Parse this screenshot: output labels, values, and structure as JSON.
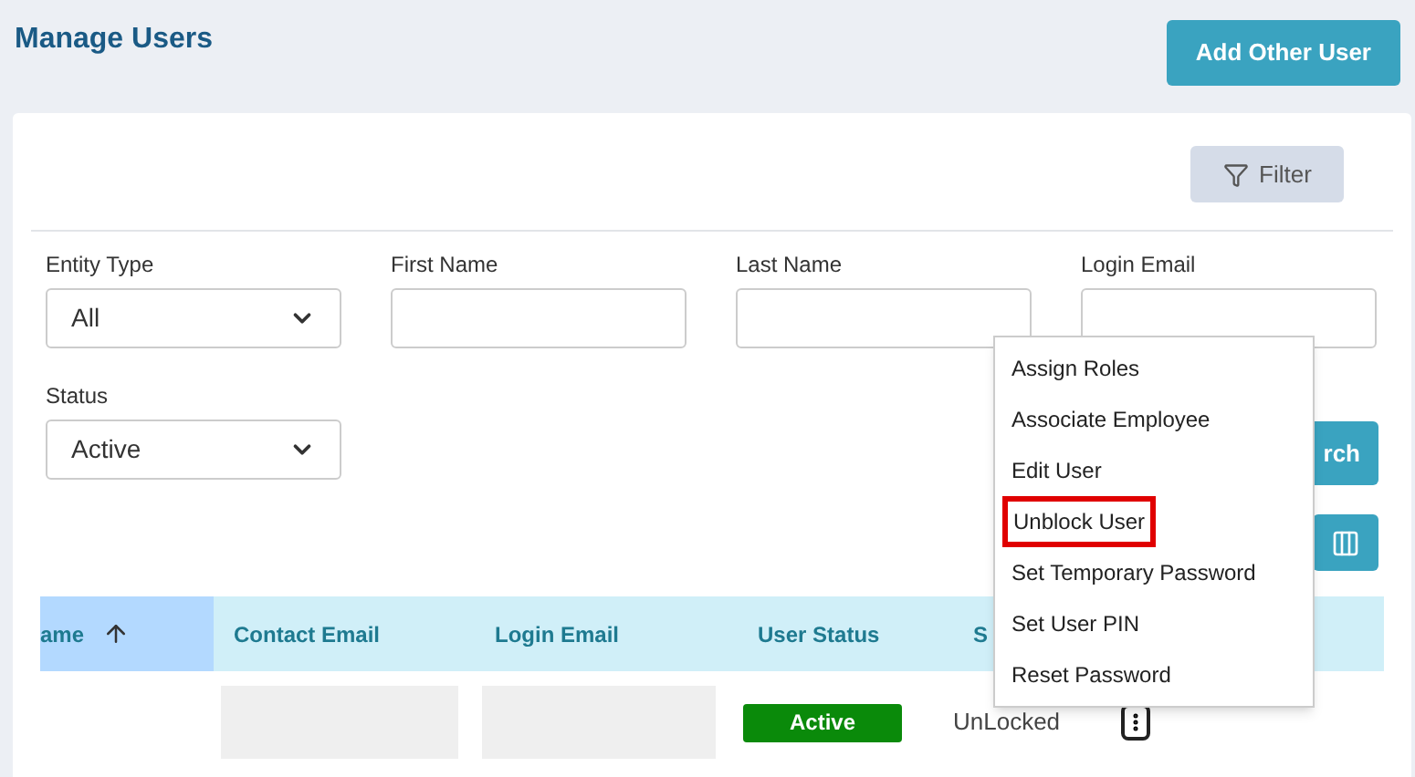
{
  "title": "Manage Users",
  "add_button": "Add Other User",
  "filter_button": "Filter",
  "filters": [
    {
      "label": "Entity Type",
      "kind": "select",
      "value": "All"
    },
    {
      "label": "First Name",
      "kind": "text"
    },
    {
      "label": "Last Name",
      "kind": "text"
    },
    {
      "label": "Login Email",
      "kind": "text"
    },
    {
      "label": "Status",
      "kind": "select",
      "value": "Active"
    }
  ],
  "search_button": "rch",
  "table": {
    "columns": [
      {
        "label": "ame",
        "sorted": true
      },
      {
        "label": "Contact Email",
        "sorted": false
      },
      {
        "label": "Login Email",
        "sorted": false
      },
      {
        "label": "User Status",
        "sorted": false
      },
      {
        "label": "S",
        "sorted": false
      }
    ],
    "rows": [
      {
        "contact_email_redacted": true,
        "login_email_redacted": true,
        "user_status": "Active",
        "lock_status": "UnLocked"
      }
    ]
  },
  "menu": [
    {
      "label": "Assign Roles",
      "highlighted": false
    },
    {
      "label": "Associate Employee",
      "highlighted": false
    },
    {
      "label": "Edit User",
      "highlighted": false
    },
    {
      "label": "Unblock User",
      "highlighted": true
    },
    {
      "label": "Set Temporary Password",
      "highlighted": false
    },
    {
      "label": "Set User PIN",
      "highlighted": false
    },
    {
      "label": "Reset Password",
      "highlighted": false
    }
  ]
}
